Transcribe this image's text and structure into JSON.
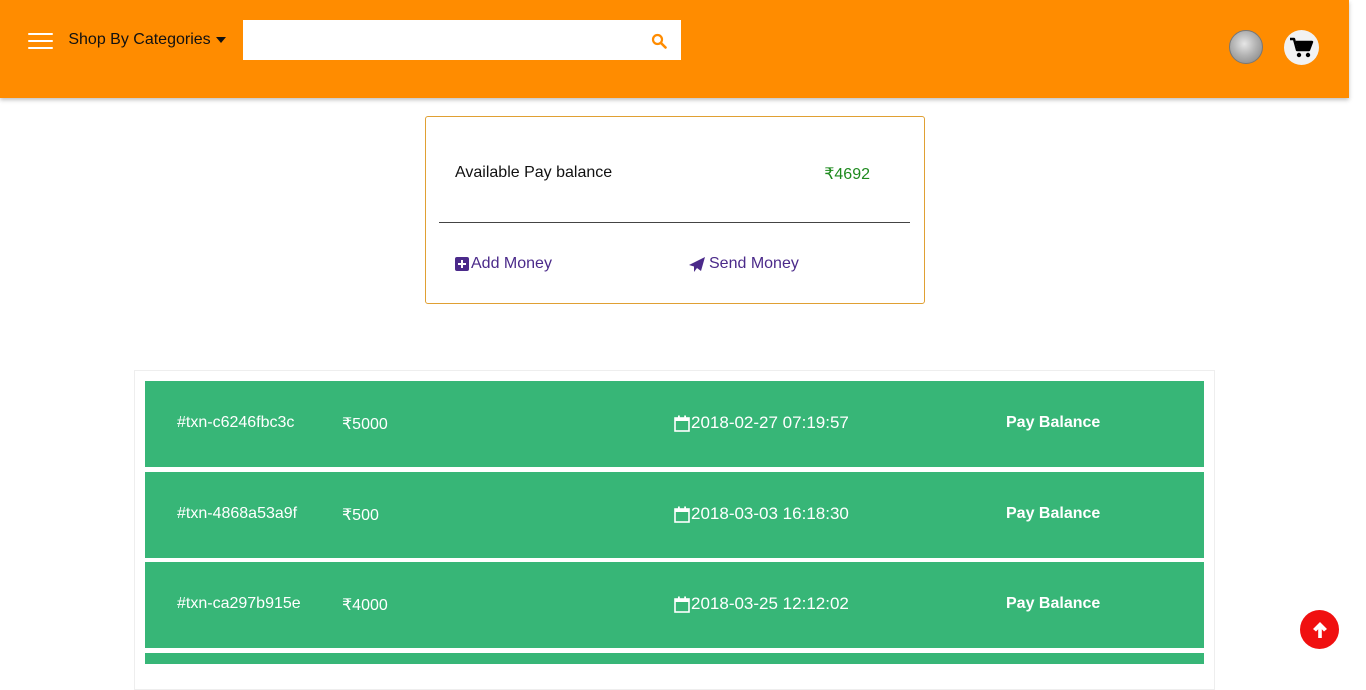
{
  "header": {
    "menu_icon": "hamburger-menu-icon",
    "categories_label": "Shop By Categories",
    "search": {
      "value": "",
      "placeholder": ""
    },
    "colors": {
      "bar": "#ff8c00"
    }
  },
  "wallet": {
    "balance_label": "Available Pay balance",
    "balance_value": "₹4692",
    "add_money_label": "Add Money",
    "send_money_label": "Send Money"
  },
  "transactions": [
    {
      "id": "#txn-c6246fbc3c",
      "amount": "₹5000",
      "datetime": "2018-02-27 07:19:57",
      "type": "Pay Balance"
    },
    {
      "id": "#txn-4868a53a9f",
      "amount": "₹500",
      "datetime": "2018-03-03 16:18:30",
      "type": "Pay Balance"
    },
    {
      "id": "#txn-ca297b915e",
      "amount": "₹4000",
      "datetime": "2018-03-25 12:12:02",
      "type": "Pay Balance"
    },
    {
      "id": "",
      "amount": "",
      "datetime": "",
      "type": ""
    }
  ],
  "colors": {
    "row": "#37b677",
    "balance": "#1e8a1e",
    "link": "#4b2a8a",
    "scroll_top": "#f01010"
  }
}
